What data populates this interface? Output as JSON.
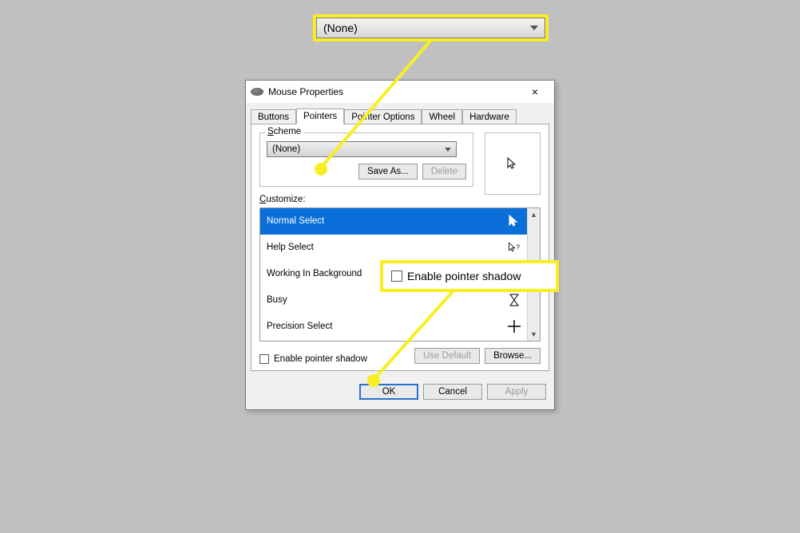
{
  "callouts": {
    "dropdown_value": "(None)",
    "checkbox_label": "Enable pointer shadow"
  },
  "dialog": {
    "title": "Mouse Properties",
    "tabs": {
      "buttons": "Buttons",
      "pointers": "Pointers",
      "pointer_options": "Pointer Options",
      "wheel": "Wheel",
      "hardware": "Hardware"
    },
    "scheme": {
      "group_label": "Scheme",
      "value": "(None)",
      "save_as": "Save As...",
      "delete": "Delete"
    },
    "customize_label": "Customize:",
    "customize_items": {
      "normal": "Normal Select",
      "help": "Help Select",
      "working": "Working In Background",
      "busy": "Busy",
      "precision": "Precision Select"
    },
    "enable_shadow": "Enable pointer shadow",
    "use_default": "Use Default",
    "browse": "Browse...",
    "ok": "OK",
    "cancel": "Cancel",
    "apply": "Apply"
  },
  "icons": {
    "close": "×",
    "up": "▲",
    "down": "▼"
  }
}
